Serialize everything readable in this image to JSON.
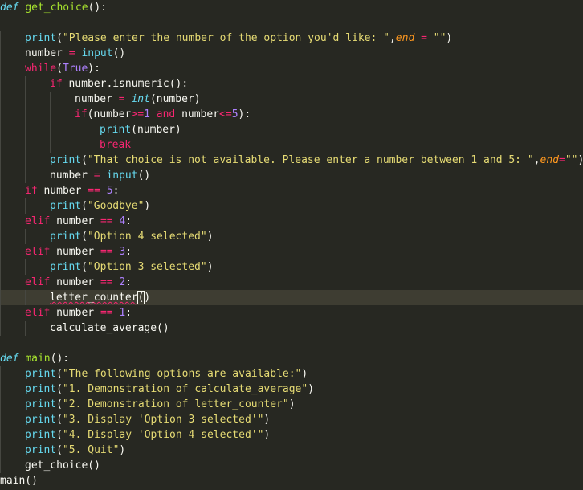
{
  "editor": {
    "current_line": 19,
    "lines": [
      {
        "indent": 0,
        "tokens": [
          {
            "t": "def",
            "c": "def"
          },
          {
            "t": " "
          },
          {
            "t": "get_choice",
            "c": "fn"
          },
          {
            "t": "():"
          }
        ]
      },
      {
        "indent": 0,
        "tokens": []
      },
      {
        "indent": 1,
        "tokens": [
          {
            "t": "print",
            "c": "bi"
          },
          {
            "t": "("
          },
          {
            "t": "\"Please enter the number of the option you'd like: \"",
            "c": "str"
          },
          {
            "t": ","
          },
          {
            "t": "end",
            "c": "param"
          },
          {
            "t": " = ",
            "c": "op"
          },
          {
            "t": "\"\"",
            "c": "str"
          },
          {
            "t": ")"
          }
        ]
      },
      {
        "indent": 1,
        "tokens": [
          {
            "t": "number "
          },
          {
            "t": "=",
            "c": "op"
          },
          {
            "t": " "
          },
          {
            "t": "input",
            "c": "bi"
          },
          {
            "t": "()"
          }
        ]
      },
      {
        "indent": 1,
        "tokens": [
          {
            "t": "while",
            "c": "kw"
          },
          {
            "t": "("
          },
          {
            "t": "True",
            "c": "num"
          },
          {
            "t": "):"
          }
        ]
      },
      {
        "indent": 2,
        "tokens": [
          {
            "t": "if",
            "c": "kw"
          },
          {
            "t": " number.isnumeric():"
          }
        ]
      },
      {
        "indent": 3,
        "tokens": [
          {
            "t": "number "
          },
          {
            "t": "=",
            "c": "op"
          },
          {
            "t": " "
          },
          {
            "t": "int",
            "c": "ty"
          },
          {
            "t": "(number)"
          }
        ]
      },
      {
        "indent": 3,
        "tokens": [
          {
            "t": "if",
            "c": "kw"
          },
          {
            "t": "(number"
          },
          {
            "t": ">=",
            "c": "op"
          },
          {
            "t": "1",
            "c": "num"
          },
          {
            "t": " "
          },
          {
            "t": "and",
            "c": "kw"
          },
          {
            "t": " number"
          },
          {
            "t": "<=",
            "c": "op"
          },
          {
            "t": "5",
            "c": "num"
          },
          {
            "t": "):"
          }
        ]
      },
      {
        "indent": 4,
        "tokens": [
          {
            "t": "print",
            "c": "bi"
          },
          {
            "t": "(number)"
          }
        ]
      },
      {
        "indent": 4,
        "tokens": [
          {
            "t": "break",
            "c": "kw"
          }
        ]
      },
      {
        "indent": 2,
        "tokens": [
          {
            "t": "print",
            "c": "bi"
          },
          {
            "t": "("
          },
          {
            "t": "\"That choice is not available. Please enter a number between 1 and 5: \"",
            "c": "str"
          },
          {
            "t": ","
          },
          {
            "t": "end",
            "c": "param"
          },
          {
            "t": "=",
            "c": "op"
          },
          {
            "t": "\"\"",
            "c": "str"
          },
          {
            "t": ")"
          }
        ]
      },
      {
        "indent": 2,
        "tokens": [
          {
            "t": "number "
          },
          {
            "t": "=",
            "c": "op"
          },
          {
            "t": " "
          },
          {
            "t": "input",
            "c": "bi"
          },
          {
            "t": "()"
          }
        ]
      },
      {
        "indent": 1,
        "tokens": [
          {
            "t": "if",
            "c": "kw"
          },
          {
            "t": " number "
          },
          {
            "t": "==",
            "c": "op"
          },
          {
            "t": " "
          },
          {
            "t": "5",
            "c": "num"
          },
          {
            "t": ":"
          }
        ]
      },
      {
        "indent": 2,
        "tokens": [
          {
            "t": "print",
            "c": "bi"
          },
          {
            "t": "("
          },
          {
            "t": "\"Goodbye\"",
            "c": "str"
          },
          {
            "t": ")"
          }
        ]
      },
      {
        "indent": 1,
        "tokens": [
          {
            "t": "elif",
            "c": "kw"
          },
          {
            "t": " number "
          },
          {
            "t": "==",
            "c": "op"
          },
          {
            "t": " "
          },
          {
            "t": "4",
            "c": "num"
          },
          {
            "t": ":"
          }
        ]
      },
      {
        "indent": 2,
        "tokens": [
          {
            "t": "print",
            "c": "bi"
          },
          {
            "t": "("
          },
          {
            "t": "\"Option 4 selected\"",
            "c": "str"
          },
          {
            "t": ")"
          }
        ]
      },
      {
        "indent": 1,
        "tokens": [
          {
            "t": "elif",
            "c": "kw"
          },
          {
            "t": " number "
          },
          {
            "t": "==",
            "c": "op"
          },
          {
            "t": " "
          },
          {
            "t": "3",
            "c": "num"
          },
          {
            "t": ":"
          }
        ]
      },
      {
        "indent": 2,
        "tokens": [
          {
            "t": "print",
            "c": "bi"
          },
          {
            "t": "("
          },
          {
            "t": "\"Option 3 selected\"",
            "c": "str"
          },
          {
            "t": ")"
          }
        ]
      },
      {
        "indent": 1,
        "tokens": [
          {
            "t": "elif",
            "c": "kw"
          },
          {
            "t": " number "
          },
          {
            "t": "==",
            "c": "op"
          },
          {
            "t": " "
          },
          {
            "t": "2",
            "c": "num"
          },
          {
            "t": ":"
          }
        ]
      },
      {
        "indent": 2,
        "tokens": [
          {
            "t": "letter_counter",
            "c": "squig"
          },
          {
            "t": "(",
            "c": "cursor"
          },
          {
            "t": ")"
          }
        ]
      },
      {
        "indent": 1,
        "tokens": [
          {
            "t": "elif",
            "c": "kw"
          },
          {
            "t": " number "
          },
          {
            "t": "==",
            "c": "op"
          },
          {
            "t": " "
          },
          {
            "t": "1",
            "c": "num"
          },
          {
            "t": ":"
          }
        ]
      },
      {
        "indent": 2,
        "tokens": [
          {
            "t": "calculate_average()"
          }
        ]
      },
      {
        "indent": 0,
        "tokens": []
      },
      {
        "indent": 0,
        "tokens": [
          {
            "t": "def",
            "c": "def"
          },
          {
            "t": " "
          },
          {
            "t": "main",
            "c": "fn"
          },
          {
            "t": "():"
          }
        ]
      },
      {
        "indent": 1,
        "tokens": [
          {
            "t": "print",
            "c": "bi"
          },
          {
            "t": "("
          },
          {
            "t": "\"The following options are available:\"",
            "c": "str"
          },
          {
            "t": ")"
          }
        ]
      },
      {
        "indent": 1,
        "tokens": [
          {
            "t": "print",
            "c": "bi"
          },
          {
            "t": "("
          },
          {
            "t": "\"1. Demonstration of calculate_average\"",
            "c": "str"
          },
          {
            "t": ")"
          }
        ]
      },
      {
        "indent": 1,
        "tokens": [
          {
            "t": "print",
            "c": "bi"
          },
          {
            "t": "("
          },
          {
            "t": "\"2. Demonstration of letter_counter\"",
            "c": "str"
          },
          {
            "t": ")"
          }
        ]
      },
      {
        "indent": 1,
        "tokens": [
          {
            "t": "print",
            "c": "bi"
          },
          {
            "t": "("
          },
          {
            "t": "\"3. Display 'Option 3 selected'\"",
            "c": "str"
          },
          {
            "t": ")"
          }
        ]
      },
      {
        "indent": 1,
        "tokens": [
          {
            "t": "print",
            "c": "bi"
          },
          {
            "t": "("
          },
          {
            "t": "\"4. Display 'Option 4 selected'\"",
            "c": "str"
          },
          {
            "t": ")"
          }
        ]
      },
      {
        "indent": 1,
        "tokens": [
          {
            "t": "print",
            "c": "bi"
          },
          {
            "t": "("
          },
          {
            "t": "\"5. Quit\"",
            "c": "str"
          },
          {
            "t": ")"
          }
        ]
      },
      {
        "indent": 1,
        "tokens": [
          {
            "t": "get_choice()"
          }
        ]
      },
      {
        "indent": 0,
        "tokens": [
          {
            "t": "main()"
          }
        ]
      }
    ]
  }
}
